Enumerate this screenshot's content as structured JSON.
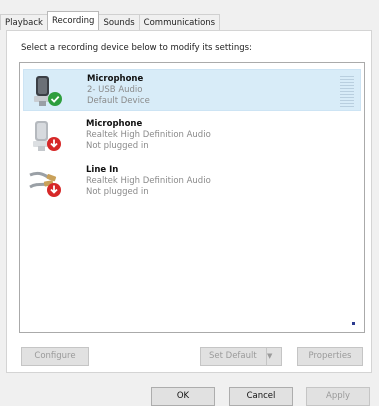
{
  "tabs": [
    "Playback",
    "Recording",
    "Sounds",
    "Communications"
  ],
  "instruction": "Select a recording device below to modify its settings:",
  "devices": [
    {
      "name": "Microphone",
      "line1": "2- USB Audio",
      "line2": "Default Device",
      "status": "default",
      "status_icon": "green-check-icon"
    },
    {
      "name": "Microphone",
      "line1": "Realtek High Definition Audio",
      "line2": "Not plugged in",
      "status": "unplugged",
      "status_icon": "red-down-arrow-icon"
    },
    {
      "name": "Line In",
      "line1": "Realtek High Definition Audio",
      "line2": "Not plugged in",
      "status": "unplugged",
      "status_icon": "red-down-arrow-icon"
    }
  ],
  "panel_buttons": {
    "configure": "Configure",
    "set_default": "Set Default",
    "properties": "Properties"
  },
  "dialog_buttons": {
    "ok": "OK",
    "cancel": "Cancel",
    "apply": "Apply"
  },
  "colors": {
    "selection": "#d8ecf8",
    "check_green": "#2e9e3e",
    "unplugged_red": "#d62828"
  }
}
